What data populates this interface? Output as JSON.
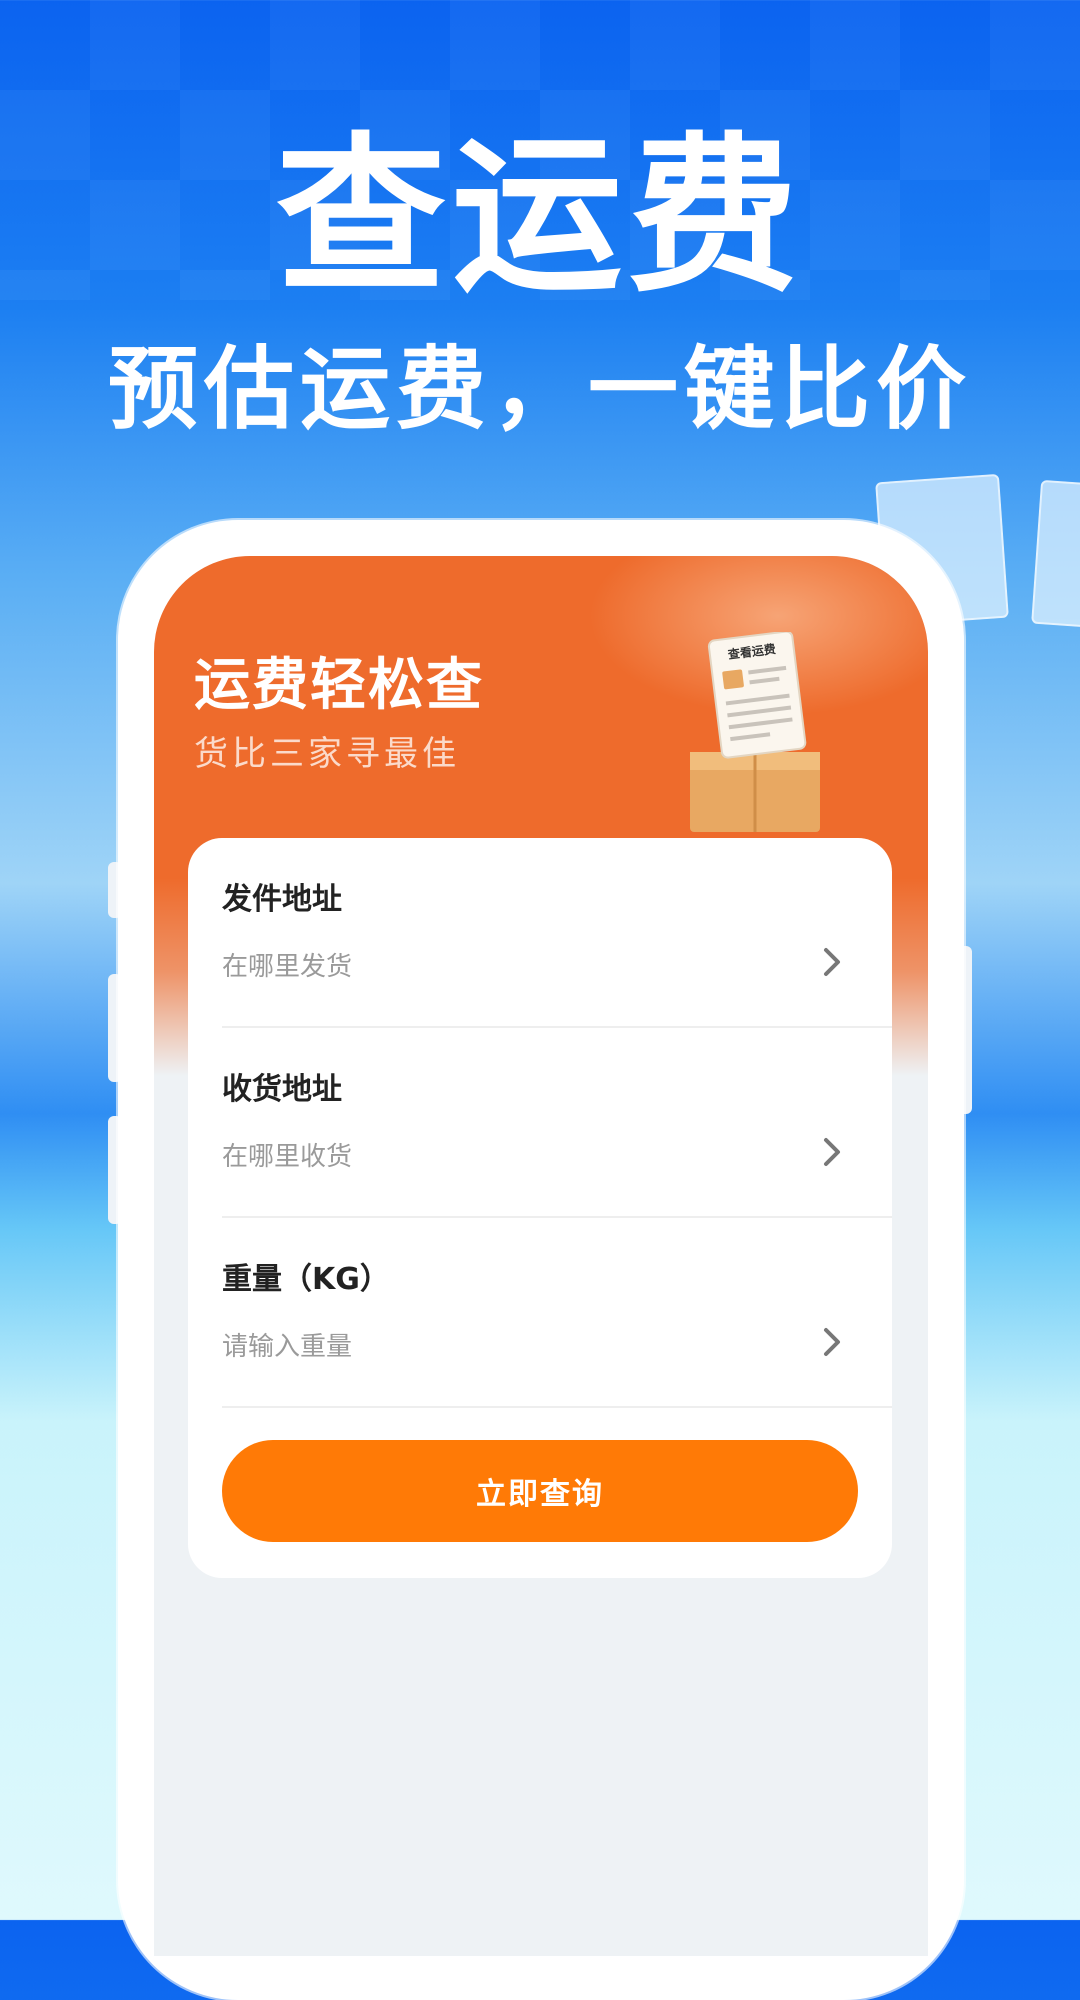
{
  "hero": {
    "title": "查运费",
    "subtitle": "预估运费，一键比价"
  },
  "app": {
    "header_title": "运费轻松查",
    "header_subtitle": "货比三家寻最佳",
    "illustration_label": "查看运费",
    "accent_color": "#ee6b2c",
    "button_color": "#ff7a06"
  },
  "form": {
    "fields": [
      {
        "label": "发件地址",
        "placeholder": "在哪里发货"
      },
      {
        "label": "收货地址",
        "placeholder": "在哪里收货"
      },
      {
        "label": "重量（KG）",
        "placeholder": "请输入重量"
      }
    ],
    "submit_label": "立即查询"
  }
}
